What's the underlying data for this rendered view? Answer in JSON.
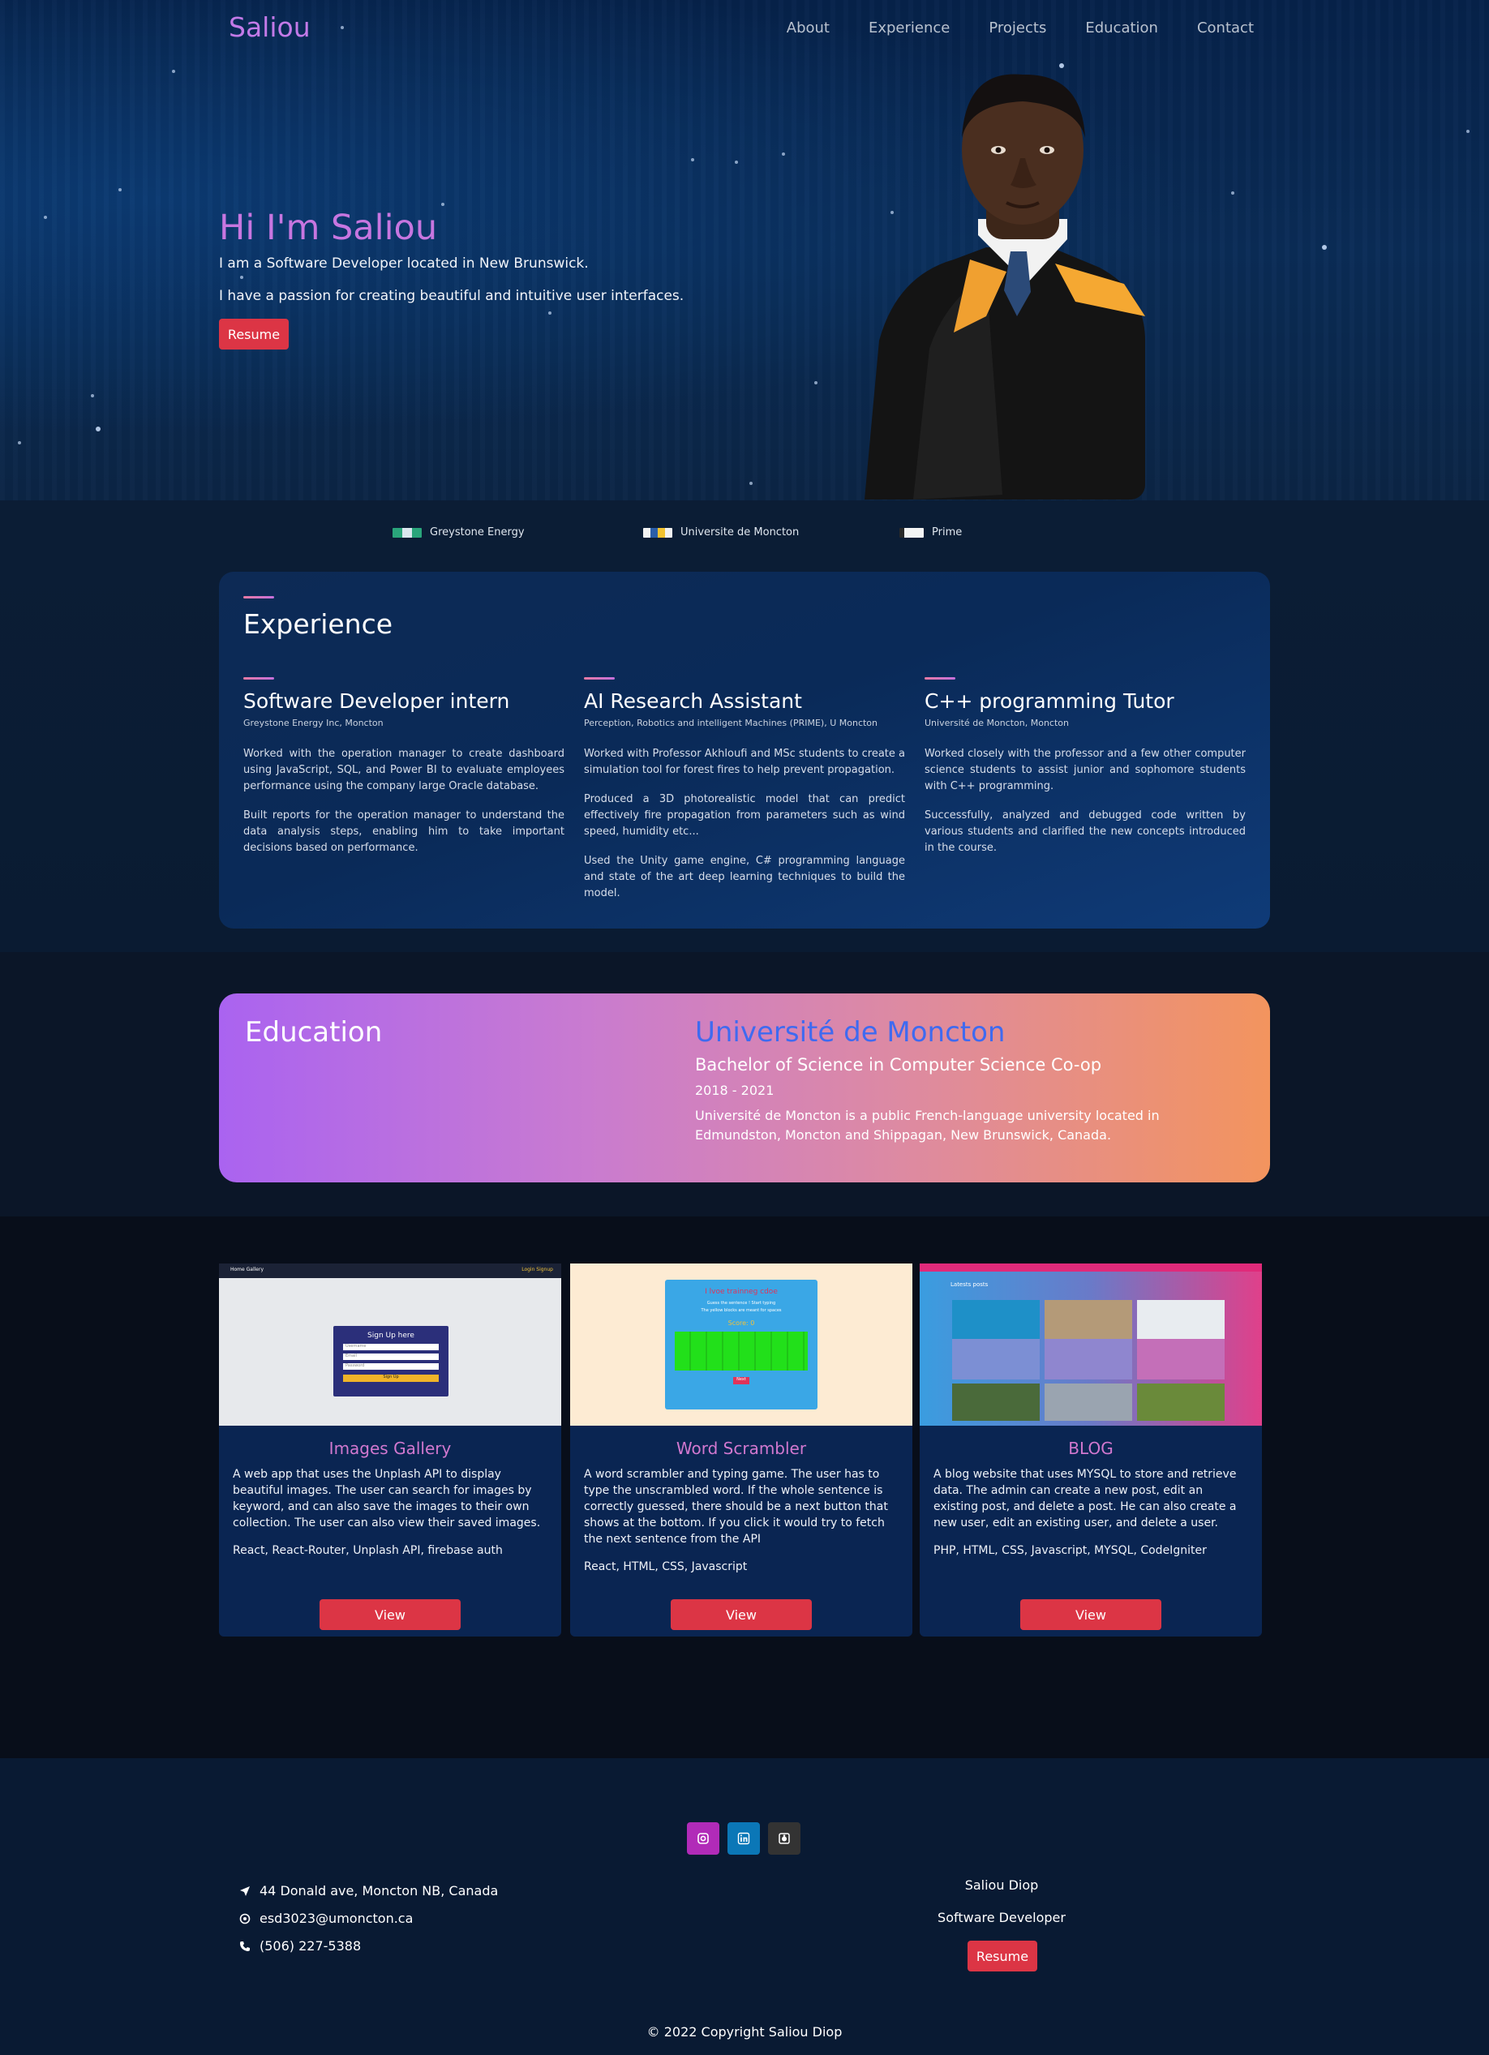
{
  "nav": {
    "logo": "Saliou",
    "links": [
      "About",
      "Experience",
      "Projects",
      "Education",
      "Contact"
    ]
  },
  "hero": {
    "title": "Hi I'm Saliou",
    "line1": "I am a Software Developer located in New Brunswick.",
    "line2": "I have a passion for creating beautiful and intuitive user interfaces.",
    "resume": "Resume"
  },
  "logos": [
    "Greystone Energy",
    "Universite de Moncton",
    "Prime"
  ],
  "experience": {
    "heading": "Experience",
    "jobs": [
      {
        "title": "Software Developer intern",
        "org": "Greystone Energy Inc, Moncton",
        "p1": "Worked with the operation manager to create dashboard using JavaScript, SQL, and Power BI to evaluate employees performance using the company large Oracle database.",
        "p2": "Built reports for the operation manager to understand the data analysis steps, enabling him to take important decisions based on performance.",
        "p3": ""
      },
      {
        "title": "AI Research Assistant",
        "org": "Perception, Robotics and intelligent Machines (PRIME), U Moncton",
        "p1": "Worked with Professor Akhloufi and MSc students to create a simulation tool for forest fires to help prevent propagation.",
        "p2": "Produced a 3D photorealistic model that can predict effectively fire propagation from parameters such as wind speed, humidity etc...",
        "p3": "Used the Unity game engine, C# programming language and state of the art deep learning techniques to build the model."
      },
      {
        "title": "C++ programming Tutor",
        "org": "Université de Moncton, Moncton",
        "p1": "Worked closely with the professor and a few other computer science students to assist junior and sophomore students with C++ programming.",
        "p2": "Successfully, analyzed and debugged code written by various students and clarified the new concepts introduced in the course.",
        "p3": ""
      }
    ]
  },
  "education": {
    "heading": "Education",
    "school": "Université de Moncton",
    "degree": "Bachelor of Science in Computer Science Co-op",
    "years": "2018 - 2021",
    "description": "Université de Moncton is a public French-language university located in Edmundston, Moncton and Shippagan, New Brunswick, Canada."
  },
  "projects": [
    {
      "title": "Images Gallery",
      "description": "A web app that uses the Unplash API to display beautiful images. The user can search for images by keyword, and can also save the images to their own collection. The user can also view their saved images.",
      "tech": "React, React-Router, Unplash API, firebase auth",
      "button": "View",
      "thumb": {
        "nav_left": "Home   Gallery",
        "nav_right": "Login  Signup",
        "form_title": "Sign Up here",
        "field1": "Username",
        "field2": "Email",
        "field3": "Password",
        "submit": "Sign Up"
      }
    },
    {
      "title": "Word Scrambler",
      "description": "A word scrambler and typing game. The user has to type the unscrambled word. If the whole sentence is correctly guessed, there should be a next button that shows at the bottom. If you click it would try to fetch the next sentence from the API",
      "tech": "React, HTML, CSS, Javascript",
      "button": "View",
      "thumb": {
        "heading": "I lvoe trainneg cdoe",
        "sub1": "Guess the sentence ! Start typing",
        "sub2": "The yellow blocks are meant for spaces",
        "score": "Score: 0",
        "next": "Next"
      }
    },
    {
      "title": "BLOG",
      "description": "A blog website that uses MYSQL to store and retrieve data. The admin can create a new post, edit an existing post, and delete a post. He can also create a new user, edit an existing user, and delete a user.",
      "tech": "PHP, HTML, CSS, Javascript, MYSQL, CodeIgniter",
      "button": "View",
      "thumb": {
        "heading": "Latests posts"
      }
    }
  ],
  "footer": {
    "address": "44 Donald ave, Moncton NB, Canada",
    "email": "esd3023@umoncton.ca",
    "phone": "(506) 227-5388",
    "name": "Saliou Diop",
    "role": "Software Developer",
    "resume": "Resume",
    "copyright": "© 2022 Copyright Saliou Diop"
  },
  "colors": {
    "accent_red": "#dc3545",
    "hero_title": "#c776e0",
    "edu_gradient_start": "#aa63f0",
    "edu_gradient_end": "#f3945e",
    "project_title": "#d178cf",
    "school_blue": "#3f6af0"
  },
  "icons": [
    "location-arrow-icon",
    "email-icon",
    "phone-icon",
    "instagram-icon",
    "linkedin-icon",
    "github-icon"
  ]
}
